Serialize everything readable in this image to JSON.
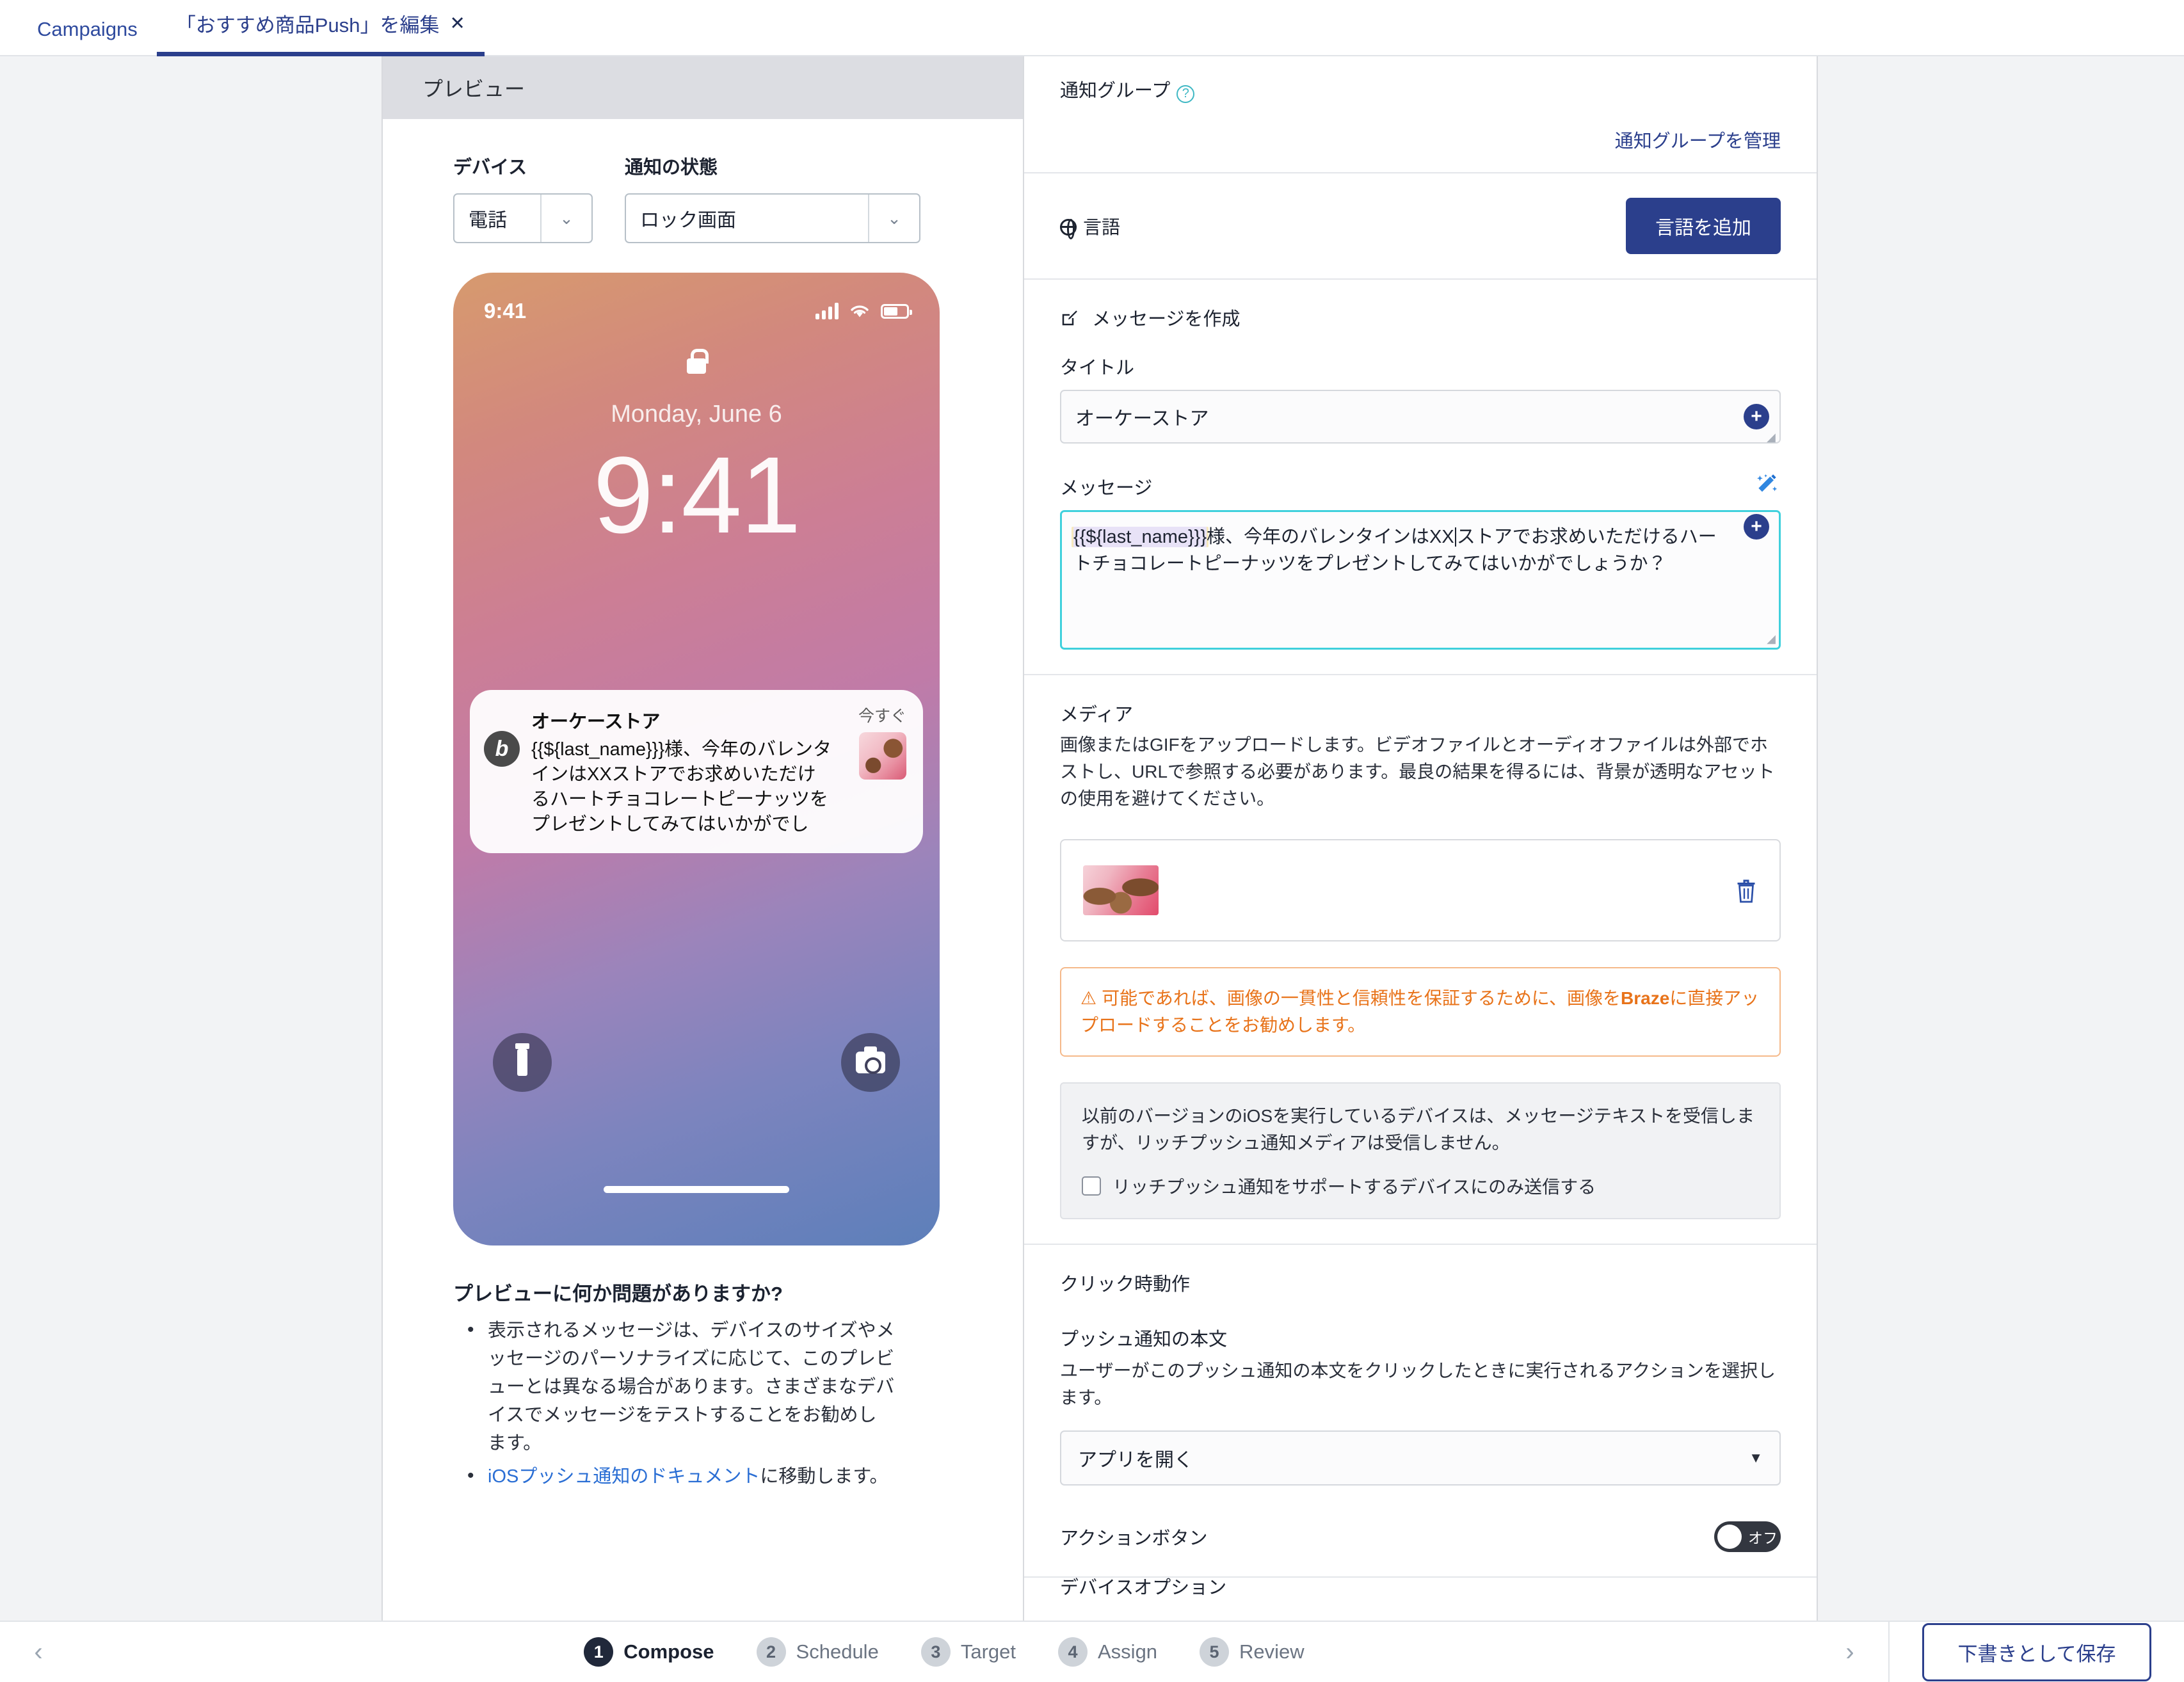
{
  "tabs": [
    {
      "label": "Campaigns",
      "active": false,
      "closable": false
    },
    {
      "label": "「おすすめ商品Push」を編集",
      "active": true,
      "closable": true,
      "close_glyph": "✕"
    }
  ],
  "preview": {
    "header_title": "プレビュー",
    "device": {
      "label": "デバイス",
      "value": "電話"
    },
    "state": {
      "label": "通知の状態",
      "value": "ロック画面"
    },
    "phone": {
      "status_time": "9:41",
      "lock_date": "Monday, June 6",
      "lock_time": "9:41",
      "notification": {
        "app_title": "オーケーストア",
        "body": "{{${last_name}}}様、今年のバレンタインはXXストアでお求めいただけるハートチョコレートピーナッツをプレゼントしてみてはいかがでし",
        "time": "今すぐ",
        "avatar_letter": "b"
      }
    },
    "help": {
      "heading": "プレビューに何か問題がありますか?",
      "bullets": [
        "表示されるメッセージは、デバイスのサイズやメッセージのパーソナライズに応じて、このプレビューとは異なる場合があります。さまざまなデバイスでメッセージをテストすることをお勧めします。"
      ],
      "link_text": "iOSプッシュ通知のドキュメント",
      "link_suffix": "に移動します。"
    }
  },
  "form": {
    "notification_group": {
      "label": "通知グループ",
      "help_glyph": "?",
      "manage_link": "通知グループを管理"
    },
    "language": {
      "label": "言語",
      "add_button": "言語を追加"
    },
    "compose": {
      "section_heading": "メッセージを作成",
      "title_label": "タイトル",
      "title_value": "オーケーストア",
      "message_label": "メッセージ",
      "message_liquid": "{{${last_name}}}",
      "message_part1": "様、今年のバレンタインはXX",
      "message_part2": "ストアでお求めいただけるハートチョコレートピーナッツをプレゼントしてみてはいかがでしょうか？"
    },
    "media": {
      "label": "メディア",
      "description": "画像またはGIFをアップロードします。ビデオファイルとオーディオファイルは外部でホストし、URLで参照する必要があります。最良の結果を得るには、背景が透明なアセットの使用を避けてください。",
      "warning_icon": "⚠",
      "warning_text_1": "可能であれば、画像の一貫性と信頼性を保証するために、画像を",
      "warning_brand": "Braze",
      "warning_text_2": "に直接アップロードすることをお勧めします。",
      "legacy_note": "以前のバージョンのiOSを実行しているデバイスは、メッセージテキストを受信しますが、リッチプッシュ通知メディアは受信しません。",
      "checkbox_label": "リッチプッシュ通知をサポートするデバイスにのみ送信する",
      "checkbox_checked": false
    },
    "click_action": {
      "section_title": "クリック時動作",
      "body_label": "プッシュ通知の本文",
      "body_desc": "ユーザーがこのプッシュ通知の本文をクリックしたときに実行されるアクションを選択します。",
      "select_value": "アプリを開く",
      "action_button_label": "アクションボタン",
      "toggle_state": "オフ",
      "clipped_next_section": "デバイスオプション"
    }
  },
  "footer": {
    "prev_glyph": "‹",
    "next_glyph": "›",
    "steps": [
      {
        "num": "1",
        "label": "Compose",
        "active": true
      },
      {
        "num": "2",
        "label": "Schedule",
        "active": false
      },
      {
        "num": "3",
        "label": "Target",
        "active": false
      },
      {
        "num": "4",
        "label": "Assign",
        "active": false
      },
      {
        "num": "5",
        "label": "Review",
        "active": false
      }
    ],
    "save_draft": "下書きとして保存"
  },
  "colors": {
    "brand_navy": "#2b3f8c",
    "accent_teal": "#3fd0dc",
    "warning_orange": "#e8731a",
    "link_blue": "#2a6ed4"
  }
}
